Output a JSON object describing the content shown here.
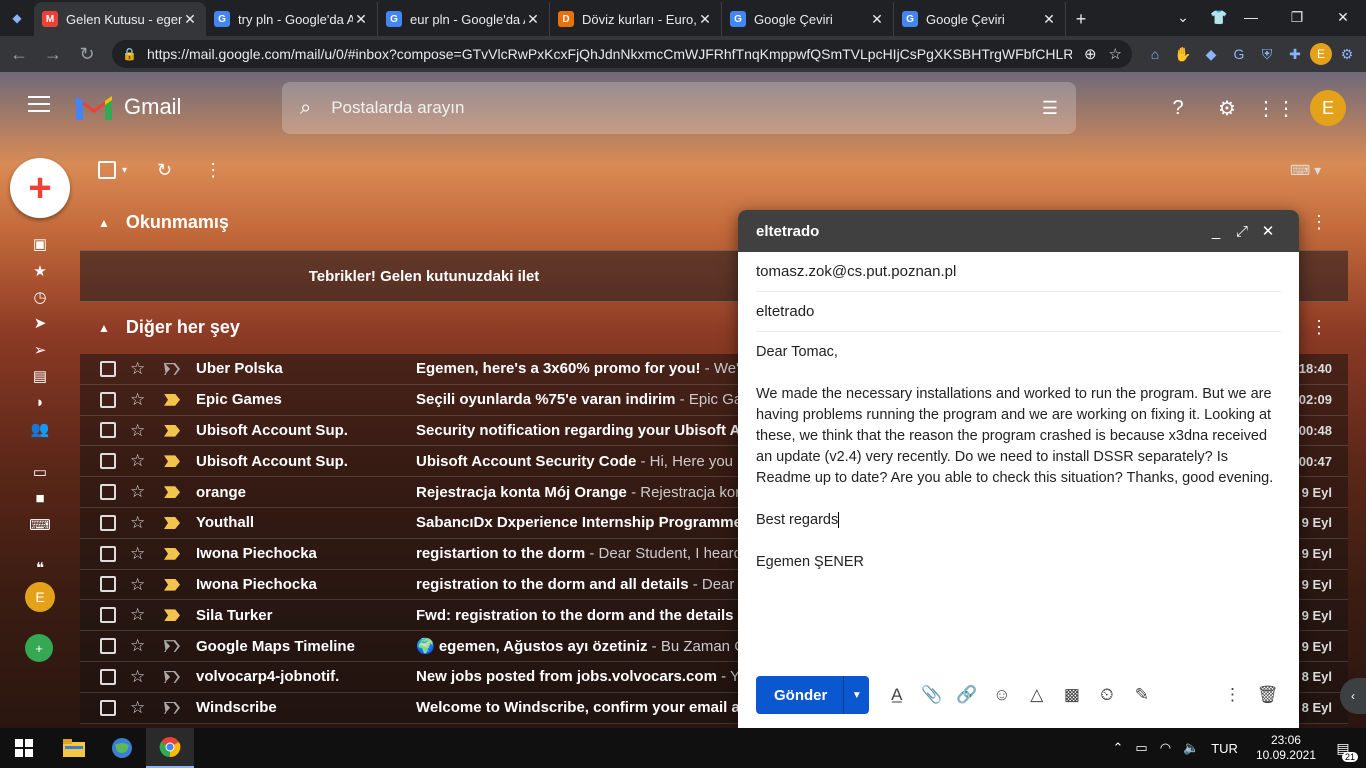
{
  "browser": {
    "tabs": [
      {
        "title": "Gelen Kutusu - egemen",
        "fav_color": "#ea4335",
        "fav_text": "M",
        "active": true
      },
      {
        "title": "try pln - Google'da Ara",
        "fav_color": "#4285f4",
        "fav_text": "G",
        "active": false
      },
      {
        "title": "eur pln - Google'da Ara",
        "fav_color": "#4285f4",
        "fav_text": "G",
        "active": false
      },
      {
        "title": "Döviz kurları - Euro, Dol",
        "fav_color": "#e8710a",
        "fav_text": "D",
        "active": false
      },
      {
        "title": "Google Çeviri",
        "fav_color": "#4285f4",
        "fav_text": "G",
        "active": false
      },
      {
        "title": "Google Çeviri",
        "fav_color": "#4285f4",
        "fav_text": "G",
        "active": false
      }
    ],
    "url": "https://mail.google.com/mail/u/0/#inbox?compose=GTvVlcRwPxKcxFjQhJdnNkxmcCmWJFRhfTnqKmppwfQSmTVLpcHIjCsPgXKSBHTrgWFbfCHLR...",
    "profile_initial": "E"
  },
  "gmail": {
    "app_name": "Gmail",
    "search_placeholder": "Postalarda arayın",
    "avatar_initial": "E",
    "sections": {
      "unread": "Okunmamış",
      "other": "Diğer her şey"
    },
    "banner": "Tebrikler! Gelen kutunuzdaki ilet",
    "emails": [
      {
        "sender": "Uber Polska",
        "subject": "Egemen, here's a 3x60% promo for you!",
        "snippet": " - We've",
        "date": "18:40",
        "important": false
      },
      {
        "sender": "Epic Games",
        "subject": "Seçili oyunlarda %75'e varan indirim",
        "snippet": " - Epic Gam",
        "date": "02:09",
        "important": true
      },
      {
        "sender": "Ubisoft Account Sup.",
        "subject": "Security notification regarding your Ubisoft Ac",
        "snippet": "",
        "date": "00:48",
        "important": true
      },
      {
        "sender": "Ubisoft Account Sup.",
        "subject": "Ubisoft Account Security Code",
        "snippet": " - Hi, Here you h",
        "date": "00:47",
        "important": true
      },
      {
        "sender": "orange",
        "subject": "Rejestracja konta Mój Orange",
        "snippet": " - Rejestracja kon",
        "date": "9 Eyl",
        "important": true
      },
      {
        "sender": "Youthall",
        "subject": "SabancıDx Dxperience Internship Programme",
        "snippet": "",
        "date": "9 Eyl",
        "important": true
      },
      {
        "sender": "Iwona Piechocka",
        "subject": "registartion to the dorm",
        "snippet": " - Dear Student, I heard",
        "date": "9 Eyl",
        "important": true
      },
      {
        "sender": "Iwona Piechocka",
        "subject": "registration to the dorm and all details",
        "snippet": " - Dear S",
        "date": "9 Eyl",
        "important": true
      },
      {
        "sender": "Sila Turker",
        "subject": "Fwd: registration to the dorm and the details",
        "snippet": " -",
        "date": "9 Eyl",
        "important": true
      },
      {
        "sender": "Google Maps Timeline",
        "subject": "🌍 egemen, Ağustos ayı özetiniz",
        "snippet": " - Bu Zaman Ç",
        "date": "9 Eyl",
        "important": false
      },
      {
        "sender": "volvocarp4-jobnotif.",
        "subject": "New jobs posted from jobs.volvocars.com",
        "snippet": " - Yo",
        "date": "8 Eyl",
        "important": false
      },
      {
        "sender": "Windscribe",
        "subject": "Welcome to Windscribe, confirm your email ad",
        "snippet": "",
        "date": "8 Eyl",
        "important": false
      }
    ]
  },
  "compose": {
    "window_title": "eltetrado",
    "to": "tomasz.zok@cs.put.poznan.pl",
    "subject": "eltetrado",
    "greeting": "Dear Tomac,",
    "paragraph": "We made the necessary installations and worked to run the program. But we are having problems running the program and we are working on fixing it. Looking at these, we think that the reason the program crashed is because x3dna received an update (v2.4) very recently. Do we need to install DSSR separately? Is Readme up to date? Are you able to check this situation? Thanks, good evening.",
    "closing": "Best regards",
    "signature": "Egemen ŞENER",
    "send_label": "Gönder"
  },
  "taskbar": {
    "language": "TUR",
    "time": "23:06",
    "date": "10.09.2021",
    "notification_count": "21"
  }
}
